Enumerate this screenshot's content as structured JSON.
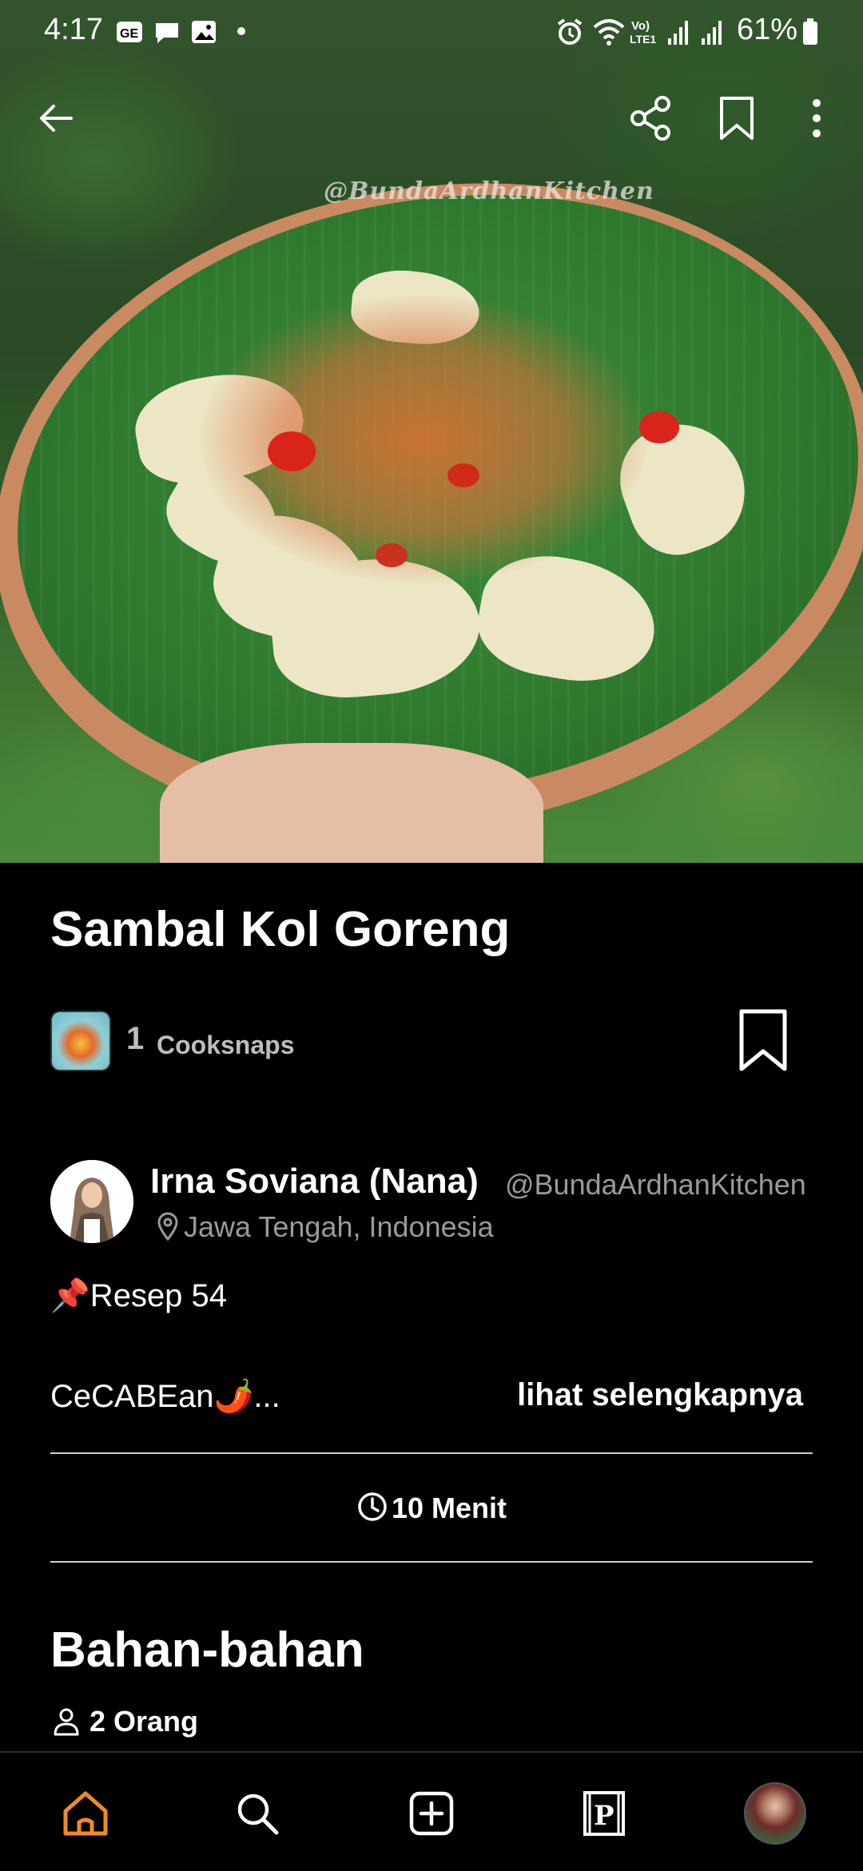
{
  "status_bar": {
    "time": "4:17",
    "battery": "61%",
    "network": "Vo) LTE1"
  },
  "hero": {
    "watermark": "@BundaArdhanKitchen",
    "back_icon": "arrow-left-icon",
    "share_icon": "share-icon",
    "bookmark_icon": "bookmark-icon",
    "more_icon": "more-vertical-icon"
  },
  "recipe": {
    "title": "Sambal Kol Goreng",
    "cooksnaps_count": "1",
    "cooksnaps_label": "Cooksnaps",
    "author_name": "Irna Soviana (Nana)",
    "author_handle": "@BundaArdhanKitchen",
    "author_location": "Jawa Tengah, Indonesia",
    "resep_line": "📌Resep 54",
    "description_preview": "CeCABEan🌶️...",
    "see_more_label": "lihat selengkapnya",
    "duration": "10 Menit",
    "ingredients_title": "Bahan-bahan",
    "servings": "2 Orang"
  },
  "bottom_nav": {
    "items": [
      "home-icon",
      "search-icon",
      "add-icon",
      "pantry-icon",
      "profile-avatar"
    ],
    "active": "home-icon"
  },
  "colors": {
    "background": "#000000",
    "accent": "#f08c21",
    "muted_text": "#9a9a9a",
    "divider": "#d0d0d0"
  }
}
